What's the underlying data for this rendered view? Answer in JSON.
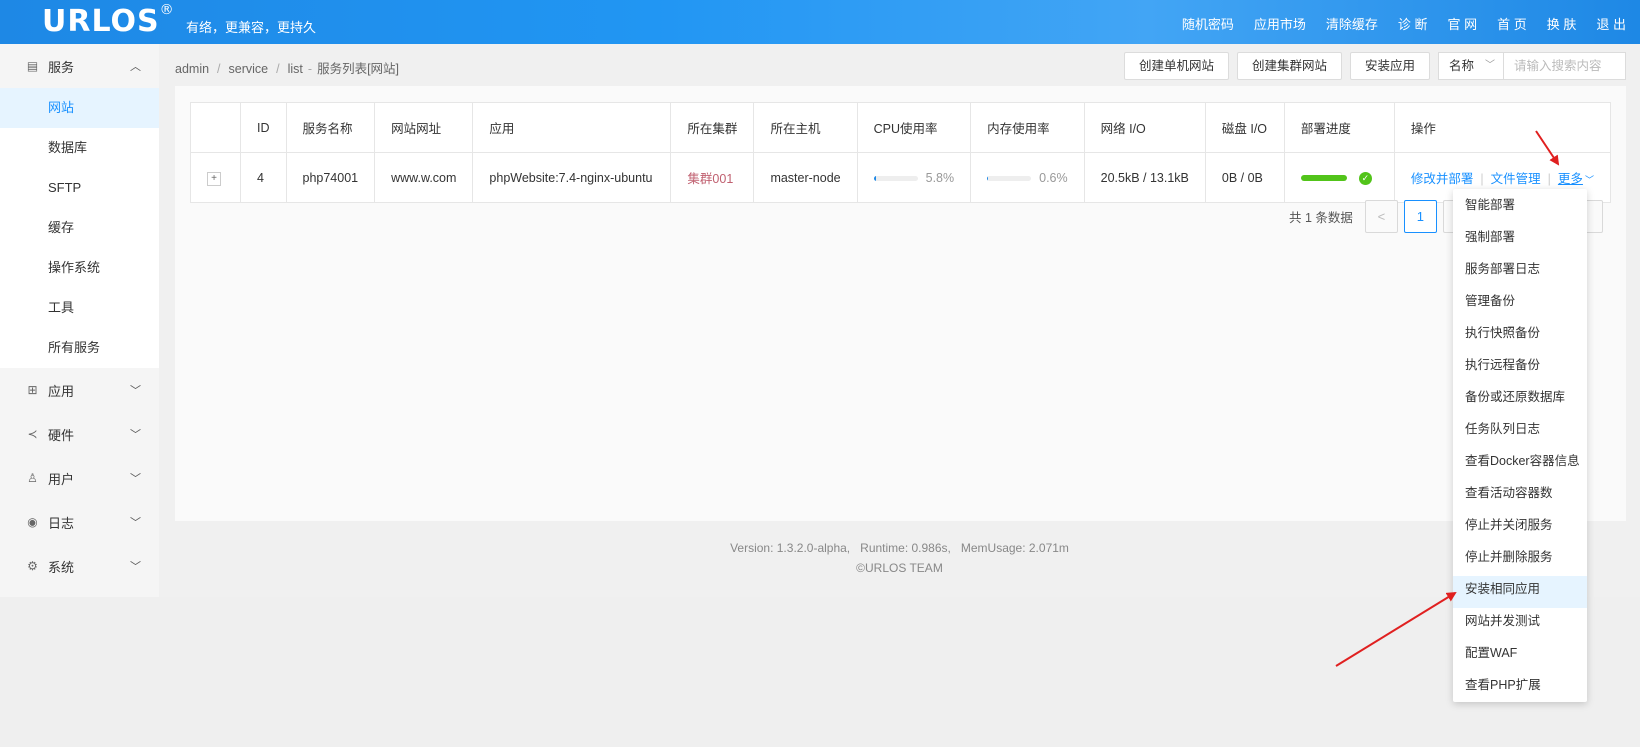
{
  "header": {
    "logo": "URLOS",
    "logo_mark": "®",
    "slogan": "有络，更兼容，更持久",
    "nav": [
      "随机密码",
      "应用市场",
      "清除缓存",
      "诊 断",
      "官 网",
      "首 页",
      "换 肤",
      "退 出"
    ]
  },
  "sidebar": {
    "groups": [
      {
        "label": "服务",
        "icon": "service-icon",
        "expanded": true,
        "items": [
          "网站",
          "数据库",
          "SFTP",
          "缓存",
          "操作系统",
          "工具",
          "所有服务"
        ]
      },
      {
        "label": "应用",
        "icon": "apps-icon"
      },
      {
        "label": "硬件",
        "icon": "share-nodes-icon"
      },
      {
        "label": "用户",
        "icon": "user-icon"
      },
      {
        "label": "日志",
        "icon": "eye-icon"
      },
      {
        "label": "系统",
        "icon": "gear-icon"
      }
    ],
    "active_item": "网站"
  },
  "breadcrumb": {
    "parts": [
      "admin",
      "service",
      "list"
    ],
    "current": "服务列表[网站]"
  },
  "toolbar": {
    "create_single": "创建单机网站",
    "create_cluster": "创建集群网站",
    "install_app": "安装应用",
    "search_field": "名称",
    "search_placeholder": "请输入搜索内容"
  },
  "table": {
    "headers": [
      "",
      "ID",
      "服务名称",
      "网站网址",
      "应用",
      "所在集群",
      "所在主机",
      "CPU使用率",
      "内存使用率",
      "网络 I/O",
      "磁盘 I/O",
      "部署进度",
      "操作"
    ],
    "rows": [
      {
        "expand": "+",
        "id": "4",
        "name": "php74001",
        "url": "www.w.com",
        "app": "phpWebsite:7.4-nginx-ubuntu",
        "cluster": "集群001",
        "host": "master-node",
        "cpu": "5.8%",
        "cpu_fraction": 0.058,
        "mem": "0.6%",
        "mem_fraction": 0.006,
        "net_io": "20.5kB / 13.1kB",
        "disk_io": "0B / 0B",
        "deploy_fraction": 1.0,
        "actions": {
          "modify": "修改并部署",
          "files": "文件管理",
          "more": "更多"
        }
      }
    ]
  },
  "pagination": {
    "total_text": "共 1 条数据",
    "prev": "<",
    "current": "1"
  },
  "footer": {
    "line1": "Version: 1.3.2.0-alpha,   Runtime: 0.986s,   MemUsage: 2.071m",
    "line2": "©URLOS TEAM"
  },
  "more_menu": {
    "items": [
      "智能部署",
      "强制部署",
      "服务部署日志",
      "管理备份",
      "执行快照备份",
      "执行远程备份",
      "备份或还原数据库",
      "任务队列日志",
      "查看Docker容器信息",
      "查看活动容器数",
      "停止并关闭服务",
      "停止并删除服务",
      "安装相同应用",
      "网站并发测试",
      "配置WAF",
      "查看PHP扩展"
    ],
    "highlighted": "安装相同应用"
  },
  "colors": {
    "header": "#2196f3",
    "accent": "#1890ff",
    "success": "#52c41a",
    "cluster": "#c06070",
    "annotation_arrow": "#e02020"
  }
}
